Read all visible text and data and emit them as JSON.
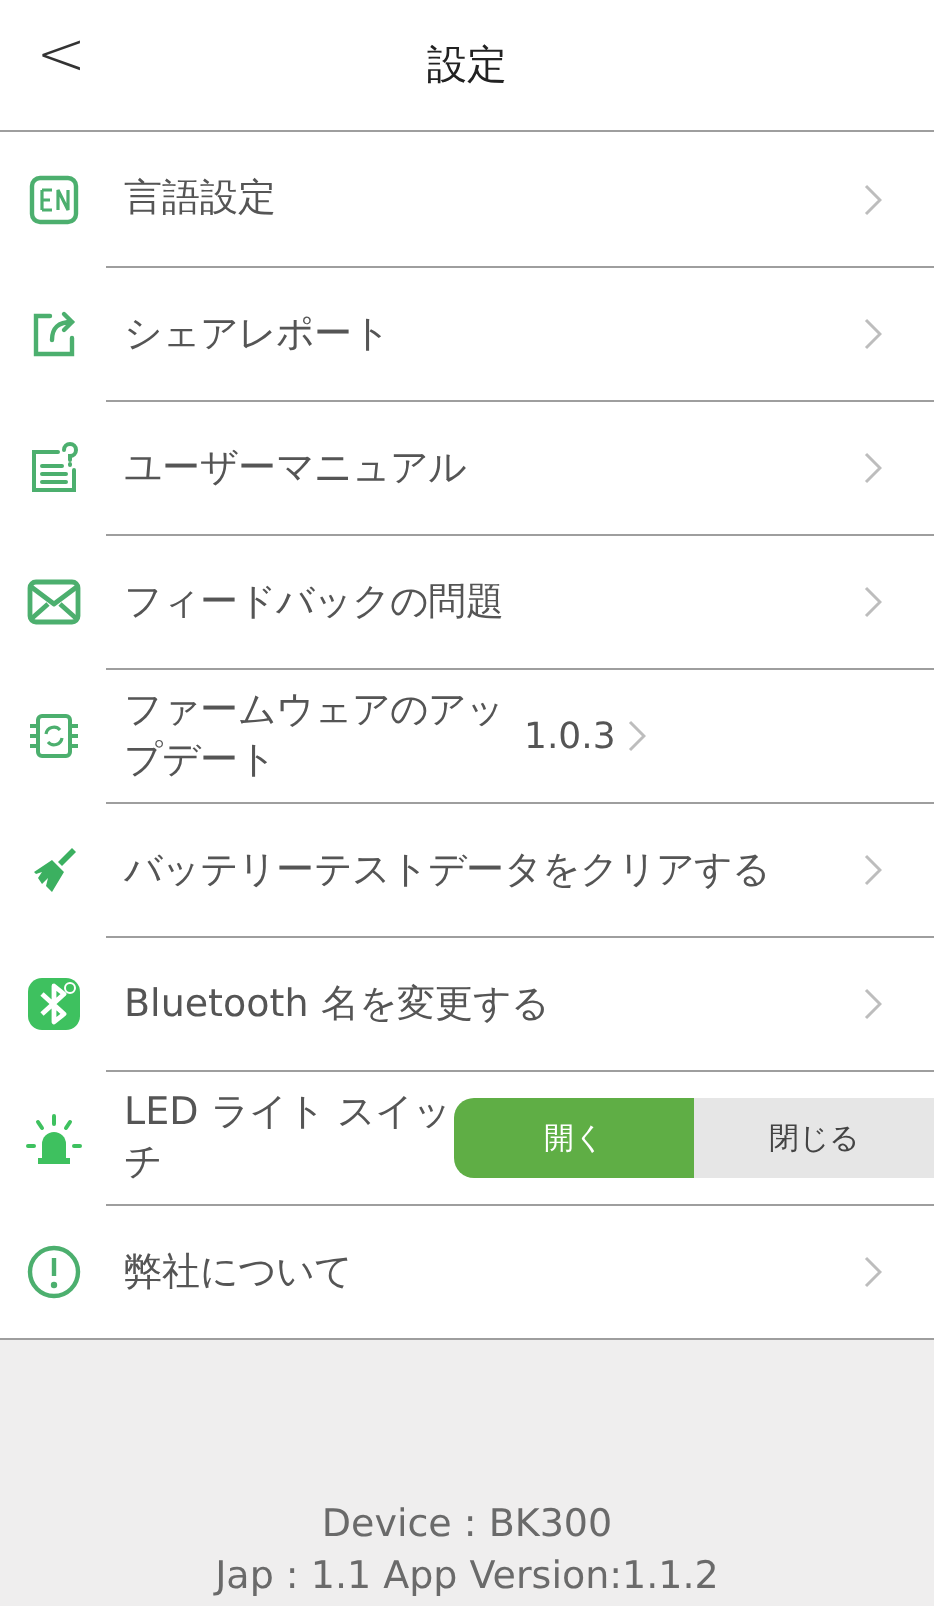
{
  "header": {
    "back": "<",
    "title": "設定"
  },
  "items": [
    {
      "kind": "link",
      "label": "言語設定"
    },
    {
      "kind": "link",
      "label": "シェアレポート"
    },
    {
      "kind": "link",
      "label": "ユーザーマニュアル"
    },
    {
      "kind": "link",
      "label": "フィードバックの問題"
    },
    {
      "kind": "link",
      "label": "ファームウェアのアップデート",
      "value": "1.0.3"
    },
    {
      "kind": "link",
      "label": "バッテリーテストデータをクリアする"
    },
    {
      "kind": "link",
      "label": "Bluetooth 名を変更する"
    },
    {
      "kind": "toggle",
      "label": "LED ライト スイッチ",
      "options": [
        {
          "label": "開く",
          "selected": true
        },
        {
          "label": "閉じる",
          "selected": false
        }
      ]
    },
    {
      "kind": "link",
      "label": "弊社について"
    }
  ],
  "footer": {
    "device": "Device : BK300",
    "version": "Jap : 1.1    App Version:1.1.2"
  }
}
